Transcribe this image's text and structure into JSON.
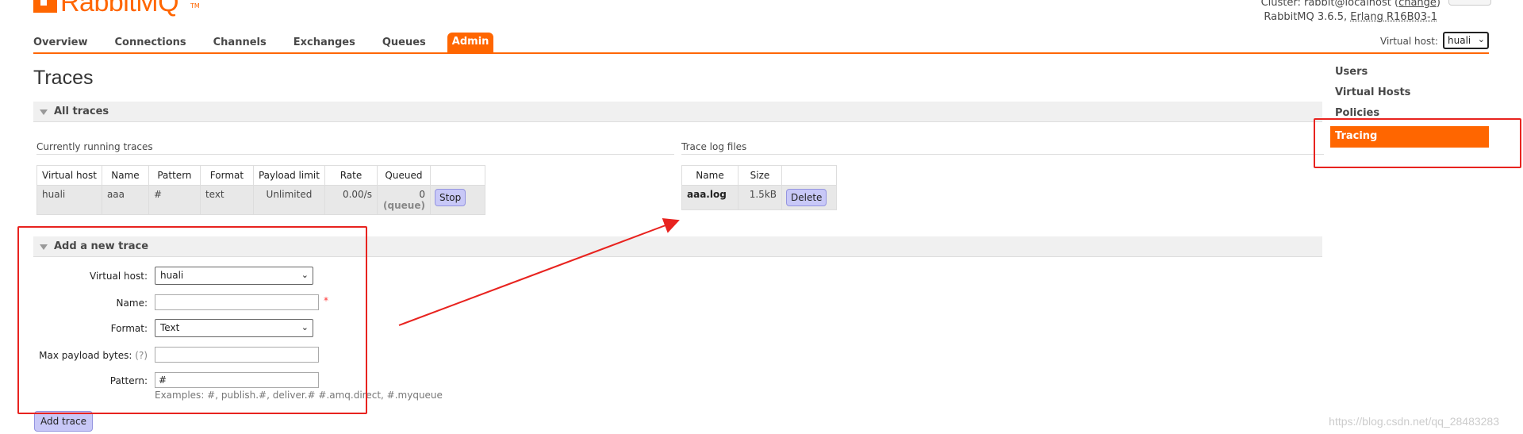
{
  "logo": {
    "text": "RabbitMQ",
    "tm": "TM"
  },
  "header": {
    "cluster_label": "Cluster: rabbit@localhost (",
    "cluster_change": "change",
    "cluster_end": ")",
    "version": "RabbitMQ 3.6.5, ",
    "erlang": "Erlang R16B03-1",
    "vhost_label": "Virtual host:",
    "vhost_selected": "huali"
  },
  "nav": {
    "overview": "Overview",
    "connections": "Connections",
    "channels": "Channels",
    "exchanges": "Exchanges",
    "queues": "Queues",
    "admin": "Admin"
  },
  "page_title": "Traces",
  "all_traces": {
    "header": "All traces",
    "running_label": "Currently running traces",
    "columns": [
      "Virtual host",
      "Name",
      "Pattern",
      "Format",
      "Payload limit",
      "Rate",
      "Queued"
    ],
    "row": {
      "vhost": "huali",
      "name": "aaa",
      "pattern": "#",
      "format": "text",
      "payload_limit": "Unlimited",
      "rate": "0.00/s",
      "queued": "0",
      "queued_sub": "(queue)",
      "stop_label": "Stop"
    },
    "logs_label": "Trace log files",
    "log_columns": [
      "Name",
      "Size"
    ],
    "log_row": {
      "name": "aaa.log",
      "size": "1.5kB",
      "delete_label": "Delete"
    }
  },
  "add_trace": {
    "header": "Add a new trace",
    "vhost_label": "Virtual host:",
    "vhost_value": "huali",
    "name_label": "Name:",
    "name_value": "",
    "required_mark": "*",
    "format_label": "Format:",
    "format_value": "Text",
    "payload_label": "Max payload bytes:",
    "payload_help": "(?)",
    "payload_value": "",
    "pattern_label": "Pattern:",
    "pattern_value": "#",
    "examples": "Examples: #, publish.#, deliver.# #.amq.direct, #.myqueue",
    "submit_label": "Add trace"
  },
  "sidebar": {
    "items": [
      "Users",
      "Virtual Hosts",
      "Policies",
      "Tracing"
    ],
    "active": "Tracing"
  },
  "annotation_colors": {
    "highlight": "#e8231f",
    "accent": "#ff6600"
  },
  "watermark": "https://blog.csdn.net/qq_28483283"
}
